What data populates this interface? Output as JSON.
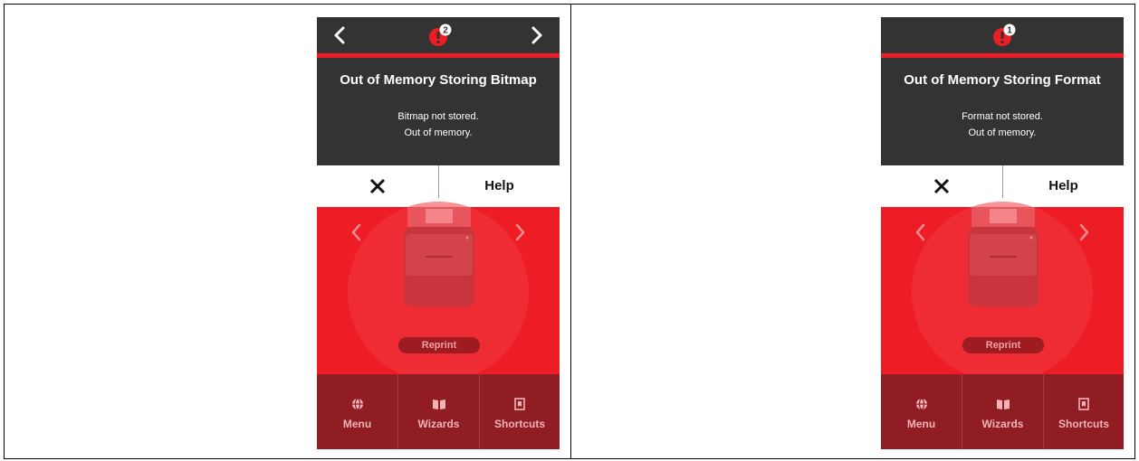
{
  "screens": [
    {
      "show_nav_arrows": true,
      "alert_count": "2",
      "title": "Out of Memory Storing Bitmap",
      "message_line1": "Bitmap not stored.",
      "message_line2": "Out of memory.",
      "help_label": "Help",
      "reprint_label": "Reprint",
      "nav": {
        "menu": "Menu",
        "wizards": "Wizards",
        "shortcuts": "Shortcuts"
      }
    },
    {
      "show_nav_arrows": false,
      "alert_count": "1",
      "title": "Out of Memory Storing Format",
      "message_line1": "Format not stored.",
      "message_line2": "Out of memory.",
      "help_label": "Help",
      "reprint_label": "Reprint",
      "nav": {
        "menu": "Menu",
        "wizards": "Wizards",
        "shortcuts": "Shortcuts"
      }
    }
  ],
  "colors": {
    "header_bg": "#333333",
    "accent_red": "#ee1c25",
    "nav_bg": "#8f1d23"
  },
  "icons": [
    "chevron-left-icon",
    "chevron-right-icon",
    "alert-badge-icon",
    "close-icon",
    "globe-icon",
    "book-icon",
    "bookmark-icon",
    "printer-illustration"
  ]
}
